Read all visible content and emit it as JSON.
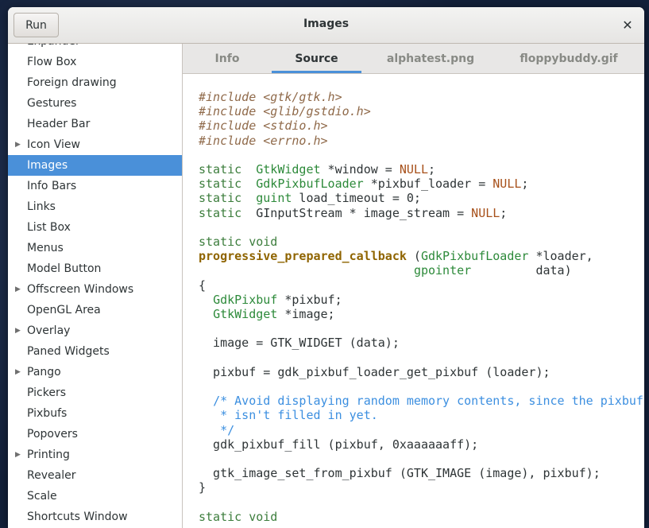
{
  "window": {
    "title": "Images",
    "run_label": "Run",
    "close_glyph": "✕"
  },
  "sidebar": {
    "items": [
      {
        "label": "Expander",
        "expandable": false,
        "selected": false
      },
      {
        "label": "Flow Box",
        "expandable": false,
        "selected": false
      },
      {
        "label": "Foreign drawing",
        "expandable": false,
        "selected": false
      },
      {
        "label": "Gestures",
        "expandable": false,
        "selected": false
      },
      {
        "label": "Header Bar",
        "expandable": false,
        "selected": false
      },
      {
        "label": "Icon View",
        "expandable": true,
        "selected": false
      },
      {
        "label": "Images",
        "expandable": false,
        "selected": true
      },
      {
        "label": "Info Bars",
        "expandable": false,
        "selected": false
      },
      {
        "label": "Links",
        "expandable": false,
        "selected": false
      },
      {
        "label": "List Box",
        "expandable": false,
        "selected": false
      },
      {
        "label": "Menus",
        "expandable": false,
        "selected": false
      },
      {
        "label": "Model Button",
        "expandable": false,
        "selected": false
      },
      {
        "label": "Offscreen Windows",
        "expandable": true,
        "selected": false
      },
      {
        "label": "OpenGL Area",
        "expandable": false,
        "selected": false
      },
      {
        "label": "Overlay",
        "expandable": true,
        "selected": false
      },
      {
        "label": "Paned Widgets",
        "expandable": false,
        "selected": false
      },
      {
        "label": "Pango",
        "expandable": true,
        "selected": false
      },
      {
        "label": "Pickers",
        "expandable": false,
        "selected": false
      },
      {
        "label": "Pixbufs",
        "expandable": false,
        "selected": false
      },
      {
        "label": "Popovers",
        "expandable": false,
        "selected": false
      },
      {
        "label": "Printing",
        "expandable": true,
        "selected": false
      },
      {
        "label": "Revealer",
        "expandable": false,
        "selected": false
      },
      {
        "label": "Scale",
        "expandable": false,
        "selected": false
      },
      {
        "label": "Shortcuts Window",
        "expandable": false,
        "selected": false
      }
    ]
  },
  "tabs": [
    {
      "label": "Info",
      "active": false
    },
    {
      "label": "Source",
      "active": true
    },
    {
      "label": "alphatest.png",
      "active": false
    },
    {
      "label": "floppybuddy.gif",
      "active": false
    }
  ],
  "code": {
    "lines": [
      [
        [
          "pp",
          "#include <gtk/gtk.h>"
        ]
      ],
      [
        [
          "pp",
          "#include <glib/gstdio.h>"
        ]
      ],
      [
        [
          "pp",
          "#include <stdio.h>"
        ]
      ],
      [
        [
          "pp",
          "#include <errno.h>"
        ]
      ],
      [],
      [
        [
          "kw",
          "static"
        ],
        [
          "",
          "  "
        ],
        [
          "ty",
          "GtkWidget"
        ],
        [
          "",
          " *window = "
        ],
        [
          "const",
          "NULL"
        ],
        [
          "",
          ";"
        ]
      ],
      [
        [
          "kw",
          "static"
        ],
        [
          "",
          "  "
        ],
        [
          "ty",
          "GdkPixbufLoader"
        ],
        [
          "",
          " *pixbuf_loader = "
        ],
        [
          "const",
          "NULL"
        ],
        [
          "",
          ";"
        ]
      ],
      [
        [
          "kw",
          "static"
        ],
        [
          "",
          "  "
        ],
        [
          "ty",
          "guint"
        ],
        [
          "",
          " load_timeout = 0;"
        ]
      ],
      [
        [
          "kw",
          "static"
        ],
        [
          "",
          ""
        ],
        [
          "",
          ""
        ],
        [
          "",
          "  GInputStream * image_stream = "
        ],
        [
          "const",
          "NULL"
        ],
        [
          "",
          ";"
        ]
      ],
      [],
      [
        [
          "kw",
          "static void"
        ]
      ],
      [
        [
          "fn",
          "progressive_prepared_callback"
        ],
        [
          "",
          " ("
        ],
        [
          "ty",
          "GdkPixbufLoader"
        ],
        [
          "",
          " *loader,"
        ]
      ],
      [
        [
          "",
          "                              "
        ],
        [
          "ty",
          "gpointer"
        ],
        [
          "",
          "         data)"
        ]
      ],
      [
        [
          "",
          "{"
        ]
      ],
      [
        [
          "",
          "  "
        ],
        [
          "ty",
          "GdkPixbuf"
        ],
        [
          "",
          " *pixbuf;"
        ]
      ],
      [
        [
          "",
          "  "
        ],
        [
          "ty",
          "GtkWidget"
        ],
        [
          "",
          " *image;"
        ]
      ],
      [],
      [
        [
          "",
          "  image = GTK_WIDGET (data);"
        ]
      ],
      [],
      [
        [
          "",
          "  pixbuf = gdk_pixbuf_loader_get_pixbuf (loader);"
        ]
      ],
      [],
      [
        [
          "",
          "  "
        ],
        [
          "cm",
          "/* Avoid displaying random memory contents, since the pixbuf"
        ]
      ],
      [
        [
          "cm",
          "   * isn't filled in yet."
        ]
      ],
      [
        [
          "cm",
          "   */"
        ]
      ],
      [
        [
          "",
          "  gdk_pixbuf_fill (pixbuf, 0xaaaaaaff);"
        ]
      ],
      [],
      [
        [
          "",
          "  gtk_image_set_from_pixbuf (GTK_IMAGE (image), pixbuf);"
        ]
      ],
      [
        [
          "",
          "}"
        ]
      ],
      [],
      [
        [
          "kw",
          "static void"
        ]
      ]
    ]
  }
}
